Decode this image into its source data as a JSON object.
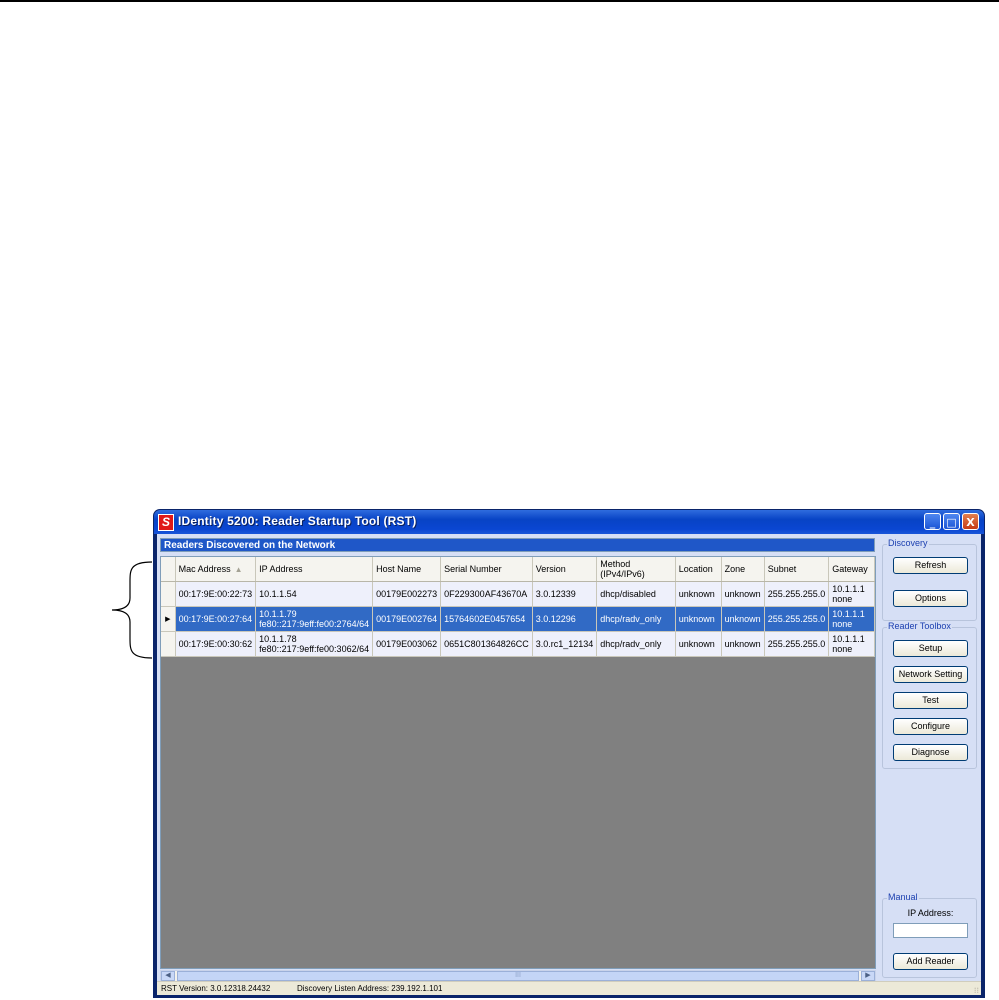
{
  "window": {
    "title": "IDentity 5200: Reader Startup Tool (RST)",
    "app_icon_letter": "S",
    "minimize_glyph": "_",
    "maximize_glyph": "□",
    "close_glyph": "X"
  },
  "grid": {
    "header": "Readers Discovered on the Network",
    "sort_indicator": "▲",
    "selected_row_indicator": "▶",
    "columns": [
      "Mac Address",
      "IP Address",
      "Host Name",
      "Serial Number",
      "Version",
      "Method (IPv4/IPv6)",
      "Location",
      "Zone",
      "Subnet",
      "Gateway"
    ],
    "rows": [
      {
        "mac": "00:17:9E:00:22:73",
        "ip1": "10.1.1.54",
        "ip2": "",
        "host": "00179E002273",
        "serial": "0F229300AF43670A",
        "version": "3.0.12339",
        "method": "dhcp/disabled",
        "location": "unknown",
        "zone": "unknown",
        "subnet": "255.255.255.0",
        "gw1": "10.1.1.1",
        "gw2": "none"
      },
      {
        "mac": "00:17:9E:00:27:64",
        "ip1": "10.1.1.79",
        "ip2": "fe80::217:9eff:fe00:2764/64",
        "host": "00179E002764",
        "serial": "15764602E0457654",
        "version": "3.0.12296",
        "method": "dhcp/radv_only",
        "location": "unknown",
        "zone": "unknown",
        "subnet": "255.255.255.0",
        "gw1": "10.1.1.1",
        "gw2": "none"
      },
      {
        "mac": "00:17:9E:00:30:62",
        "ip1": "10.1.1.78",
        "ip2": "fe80::217:9eff:fe00:3062/64",
        "host": "00179E003062",
        "serial": "0651C801364826CC",
        "version": "3.0.rc1_12134",
        "method": "dhcp/radv_only",
        "location": "unknown",
        "zone": "unknown",
        "subnet": "255.255.255.0",
        "gw1": "10.1.1.1",
        "gw2": "none"
      }
    ],
    "selected_row": 1
  },
  "scrollbar": {
    "left_glyph": "◀",
    "right_glyph": "▶",
    "thumb_glyph": "III"
  },
  "discovery": {
    "title": "Discovery",
    "refresh_label": "Refresh",
    "options_label": "Options"
  },
  "toolbox": {
    "title": "Reader Toolbox",
    "setup_label": "Setup",
    "network_label": "Network Setting",
    "test_label": "Test",
    "configure_label": "Configure",
    "diagnose_label": "Diagnose"
  },
  "manual": {
    "title": "Manual",
    "ip_label": "IP Address:",
    "ip_value": "",
    "add_label": "Add Reader"
  },
  "status": {
    "version": "RST Version: 3.0.12318.24432",
    "listen": "Discovery Listen Address: 239.192.1.101",
    "grip": "⁝⁝"
  },
  "colors": {
    "title_bar": "#0a46d2",
    "selection": "#316ac5",
    "grid_empty": "#808080",
    "panel": "#d6dff5"
  }
}
